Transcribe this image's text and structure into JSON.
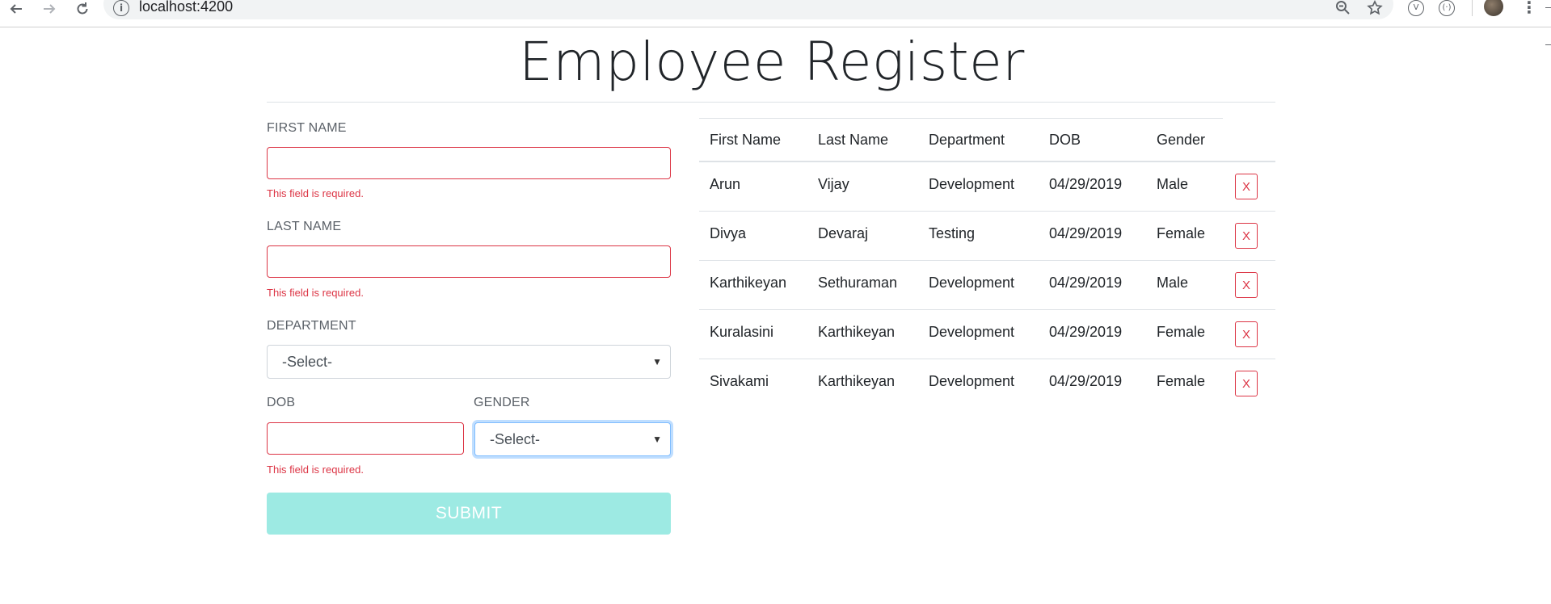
{
  "browser": {
    "url": "localhost:4200",
    "info_icon": "i",
    "back_icon": "back-arrow",
    "forward_icon": "forward-arrow",
    "reload_icon": "reload",
    "zoom_icon": "zoom-out",
    "star_icon": "star",
    "ext1": "V",
    "ext2": "(·)",
    "menu_icon": "⋮"
  },
  "page": {
    "title": "Employee Register"
  },
  "form": {
    "first_name_label": "FIRST NAME",
    "first_name_value": "",
    "first_name_error": "This field is required.",
    "last_name_label": "LAST NAME",
    "last_name_value": "",
    "last_name_error": "This field is required.",
    "department_label": "DEPARTMENT",
    "department_selected": "-Select-",
    "dob_label": "DOB",
    "dob_value": "",
    "dob_error": "This field is required.",
    "gender_label": "GENDER",
    "gender_selected": "-Select-",
    "submit_label": "SUBMIT"
  },
  "table": {
    "headers": [
      "First Name",
      "Last Name",
      "Department",
      "DOB",
      "Gender"
    ],
    "delete_label": "X",
    "rows": [
      [
        "Arun",
        "Vijay",
        "Development",
        "04/29/2019",
        "Male"
      ],
      [
        "Divya",
        "Devaraj",
        "Testing",
        "04/29/2019",
        "Female"
      ],
      [
        "Karthikeyan",
        "Sethuraman",
        "Development",
        "04/29/2019",
        "Male"
      ],
      [
        "Kuralasini",
        "Karthikeyan",
        "Development",
        "04/29/2019",
        "Female"
      ],
      [
        "Sivakami",
        "Karthikeyan",
        "Development",
        "04/29/2019",
        "Female"
      ]
    ]
  },
  "colors": {
    "error": "#dc3545",
    "submit_bg": "#9deae3",
    "focus": "#80bdff"
  }
}
